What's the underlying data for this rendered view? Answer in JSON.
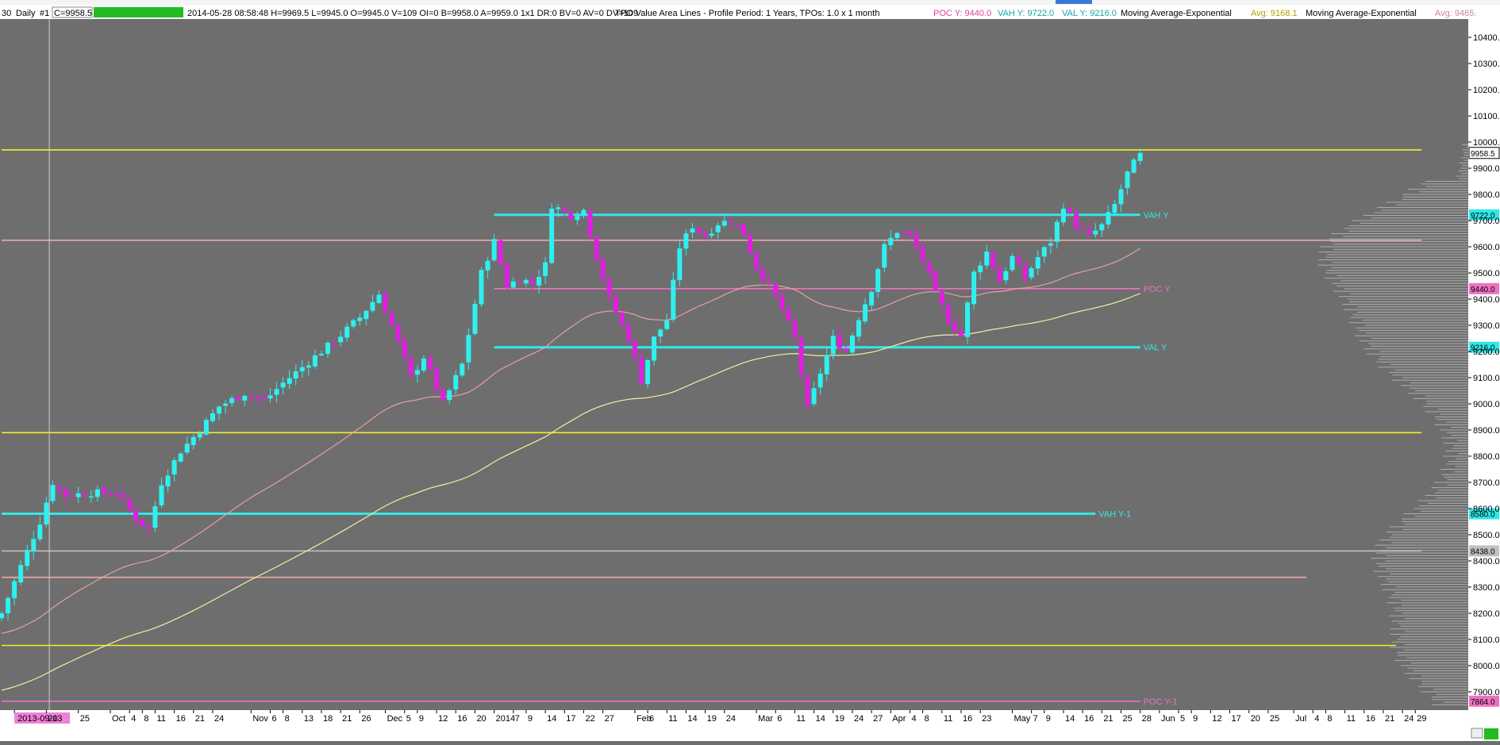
{
  "header": {
    "symbol_fragment": "30",
    "period": "Daily",
    "chart_no": "#1",
    "close_label": "C=9958.5",
    "status_badge": "",
    "info": "2014-05-28 08:58:48 H=9969.5 L=9945.0 O=9945.0 V=109 OI=0 B=9958.0 A=9959.0 1x1 DR:0 BV=0 AV=0 DV=109",
    "study_tpo": "TPO Value Area Lines - Profile Period: 1 Years, TPOs: 1.0 x 1 month",
    "poc_y": "POC Y: 9440.0",
    "vah_y": "VAH Y: 9722.0",
    "val_y": "VAL Y: 9216.0",
    "ma1_name": "Moving Average-Exponential",
    "ma1_value": "Avg: 9168.1",
    "ma2_name": "Moving Average-Exponential",
    "ma2_value": "Avg: 9465."
  },
  "colors": {
    "background": "#6e6e6e",
    "up": "#2ff0f0",
    "down": "#e020e0",
    "yellow": "#f0f020",
    "cyan": "#30e8e8",
    "pink": "#f070c0",
    "salmon": "#f0a8a8",
    "profile": "#c0c0c0"
  },
  "chart_data": {
    "type": "candlestick",
    "ylim": [
      7830,
      10470
    ],
    "y_ticks": [
      7900,
      8000,
      8100,
      8200,
      8300,
      8400,
      8500,
      8600,
      8700,
      8800,
      8900,
      9000,
      9100,
      9200,
      9300,
      9400,
      9500,
      9600,
      9700,
      9800,
      9900,
      10000,
      10100,
      10200,
      10300,
      10400
    ],
    "y_tick_labels": [
      "7900.0",
      "8000.0",
      "8100.0",
      "8200.0",
      "8300.0",
      "8400.0",
      "8500.0",
      "8600.0",
      "8700.0",
      "8800.0",
      "8900.0",
      "9000.0",
      "9100.0",
      "9200.0",
      "9300.0",
      "9400.0",
      "9500.0",
      "9600.0",
      "9700.0",
      "9800.0",
      "9900.0",
      "10000.0",
      "10100.0",
      "10200.0",
      "10300.0",
      "10400.0"
    ],
    "x_labels": [
      {
        "i": 2,
        "t": "2013-09-13",
        "hl": true
      },
      {
        "i": 7,
        "t": "20"
      },
      {
        "i": 12,
        "t": "25"
      },
      {
        "i": 17,
        "t": "Oct"
      },
      {
        "i": 20,
        "t": "4"
      },
      {
        "i": 22,
        "t": "8"
      },
      {
        "i": 24,
        "t": "11"
      },
      {
        "i": 27,
        "t": "16"
      },
      {
        "i": 30,
        "t": "21"
      },
      {
        "i": 33,
        "t": "24"
      },
      {
        "i": 39,
        "t": "Nov"
      },
      {
        "i": 42,
        "t": "6"
      },
      {
        "i": 44,
        "t": "8"
      },
      {
        "i": 47,
        "t": "13"
      },
      {
        "i": 50,
        "t": "18"
      },
      {
        "i": 53,
        "t": "21"
      },
      {
        "i": 56,
        "t": "26"
      },
      {
        "i": 60,
        "t": "Dec"
      },
      {
        "i": 63,
        "t": "5"
      },
      {
        "i": 65,
        "t": "9"
      },
      {
        "i": 68,
        "t": "12"
      },
      {
        "i": 71,
        "t": "16"
      },
      {
        "i": 74,
        "t": "20"
      },
      {
        "i": 77,
        "t": "2014"
      },
      {
        "i": 80,
        "t": "7"
      },
      {
        "i": 82,
        "t": "9"
      },
      {
        "i": 85,
        "t": "14"
      },
      {
        "i": 88,
        "t": "17"
      },
      {
        "i": 91,
        "t": "22"
      },
      {
        "i": 94,
        "t": "27"
      },
      {
        "i": 99,
        "t": "Feb"
      },
      {
        "i": 101,
        "t": "6"
      },
      {
        "i": 104,
        "t": "11"
      },
      {
        "i": 107,
        "t": "14"
      },
      {
        "i": 110,
        "t": "19"
      },
      {
        "i": 113,
        "t": "24"
      },
      {
        "i": 118,
        "t": "Mar"
      },
      {
        "i": 121,
        "t": "6"
      },
      {
        "i": 124,
        "t": "11"
      },
      {
        "i": 127,
        "t": "14"
      },
      {
        "i": 130,
        "t": "19"
      },
      {
        "i": 133,
        "t": "24"
      },
      {
        "i": 136,
        "t": "27"
      },
      {
        "i": 139,
        "t": "Apr"
      },
      {
        "i": 142,
        "t": "4"
      },
      {
        "i": 144,
        "t": "8"
      },
      {
        "i": 147,
        "t": "11"
      },
      {
        "i": 150,
        "t": "16"
      },
      {
        "i": 153,
        "t": "23"
      },
      {
        "i": 158,
        "t": "May"
      },
      {
        "i": 161,
        "t": "7"
      },
      {
        "i": 163,
        "t": "9"
      },
      {
        "i": 166,
        "t": "14"
      },
      {
        "i": 169,
        "t": "16"
      },
      {
        "i": 172,
        "t": "21"
      },
      {
        "i": 175,
        "t": "25"
      },
      {
        "i": 178,
        "t": "28"
      },
      {
        "i": 181,
        "t": "Jun"
      },
      {
        "i": 184,
        "t": "5"
      },
      {
        "i": 186,
        "t": "9"
      },
      {
        "i": 189,
        "t": "12"
      },
      {
        "i": 192,
        "t": "17"
      },
      {
        "i": 195,
        "t": "20"
      },
      {
        "i": 198,
        "t": "25"
      },
      {
        "i": 202,
        "t": "Jul"
      },
      {
        "i": 205,
        "t": "4"
      },
      {
        "i": 207,
        "t": "8"
      },
      {
        "i": 210,
        "t": "11"
      },
      {
        "i": 213,
        "t": "16"
      },
      {
        "i": 216,
        "t": "21"
      },
      {
        "i": 219,
        "t": "24"
      },
      {
        "i": 221,
        "t": "29"
      }
    ],
    "anchors": [
      [
        0,
        8200
      ],
      [
        3,
        8380
      ],
      [
        6,
        8550
      ],
      [
        8,
        8700
      ],
      [
        10,
        8650
      ],
      [
        14,
        8660
      ],
      [
        18,
        8660
      ],
      [
        21,
        8560
      ],
      [
        23,
        8520
      ],
      [
        25,
        8700
      ],
      [
        28,
        8820
      ],
      [
        31,
        8900
      ],
      [
        34,
        8990
      ],
      [
        38,
        9040
      ],
      [
        41,
        9010
      ],
      [
        44,
        9080
      ],
      [
        48,
        9160
      ],
      [
        52,
        9240
      ],
      [
        56,
        9330
      ],
      [
        59,
        9420
      ],
      [
        61,
        9300
      ],
      [
        64,
        9100
      ],
      [
        66,
        9180
      ],
      [
        69,
        9000
      ],
      [
        72,
        9150
      ],
      [
        75,
        9500
      ],
      [
        77,
        9620
      ],
      [
        79,
        9450
      ],
      [
        81,
        9480
      ],
      [
        83,
        9460
      ],
      [
        85,
        9530
      ],
      [
        86,
        9760
      ],
      [
        89,
        9720
      ],
      [
        91,
        9740
      ],
      [
        93,
        9560
      ],
      [
        95,
        9400
      ],
      [
        98,
        9250
      ],
      [
        100,
        9090
      ],
      [
        102,
        9250
      ],
      [
        104,
        9320
      ],
      [
        106,
        9600
      ],
      [
        108,
        9680
      ],
      [
        110,
        9640
      ],
      [
        112,
        9690
      ],
      [
        114,
        9700
      ],
      [
        116,
        9650
      ],
      [
        118,
        9520
      ],
      [
        120,
        9450
      ],
      [
        122,
        9360
      ],
      [
        124,
        9250
      ],
      [
        126,
        8980
      ],
      [
        128,
        9120
      ],
      [
        130,
        9250
      ],
      [
        132,
        9200
      ],
      [
        134,
        9330
      ],
      [
        136,
        9440
      ],
      [
        138,
        9600
      ],
      [
        140,
        9660
      ],
      [
        142,
        9640
      ],
      [
        144,
        9550
      ],
      [
        146,
        9420
      ],
      [
        148,
        9320
      ],
      [
        150,
        9260
      ],
      [
        152,
        9500
      ],
      [
        154,
        9580
      ],
      [
        156,
        9470
      ],
      [
        158,
        9560
      ],
      [
        160,
        9480
      ],
      [
        162,
        9560
      ],
      [
        164,
        9620
      ],
      [
        166,
        9760
      ],
      [
        168,
        9680
      ],
      [
        170,
        9640
      ],
      [
        172,
        9680
      ],
      [
        174,
        9760
      ],
      [
        176,
        9880
      ],
      [
        178,
        9958
      ]
    ],
    "bar_count": 179,
    "last_close": 9958.5,
    "levels": [
      {
        "name": "upper-yellow-line",
        "value": 9970,
        "color": "yellow",
        "from": 0,
        "to": 222
      },
      {
        "name": "vah-y-line",
        "value": 9722,
        "color": "cyan",
        "from": 77,
        "to": 178,
        "label": "VAH Y",
        "tag": "9722.0"
      },
      {
        "name": "salmon-upper-line",
        "value": 9625,
        "color": "salmon",
        "from": 0,
        "to": 222
      },
      {
        "name": "poc-y-line",
        "value": 9440,
        "color": "pink",
        "from": 77,
        "to": 178,
        "label": "POC Y",
        "tag": "9440.0"
      },
      {
        "name": "val-y-line",
        "value": 9216,
        "color": "cyan",
        "from": 77,
        "to": 178,
        "label": "VAL Y",
        "tag": "9216.0"
      },
      {
        "name": "middle-yellow-line",
        "value": 8890,
        "color": "yellow",
        "from": 0,
        "to": 222
      },
      {
        "name": "vah-y1-line",
        "value": 8580,
        "color": "cyan",
        "from": 0,
        "to": 171,
        "label": "VAH Y-1",
        "tag": "8580.0"
      },
      {
        "name": "grey-line",
        "value": 8438,
        "color": "profile",
        "from": 0,
        "to": 222,
        "tag": "8438.0"
      },
      {
        "name": "salmon-lower-line",
        "value": 8337,
        "color": "salmon",
        "from": 0,
        "to": 204
      },
      {
        "name": "lower-yellow-line",
        "value": 8077,
        "color": "yellow",
        "from": 0,
        "to": 218
      },
      {
        "name": "poc-y1-line",
        "value": 7864,
        "color": "pink",
        "from": 0,
        "to": 178,
        "label": "POC Y-1",
        "tag": "7864.0"
      }
    ],
    "ema_fast_end": 9465,
    "ema_slow_end": 9168.1,
    "cursor_bar": 2
  }
}
